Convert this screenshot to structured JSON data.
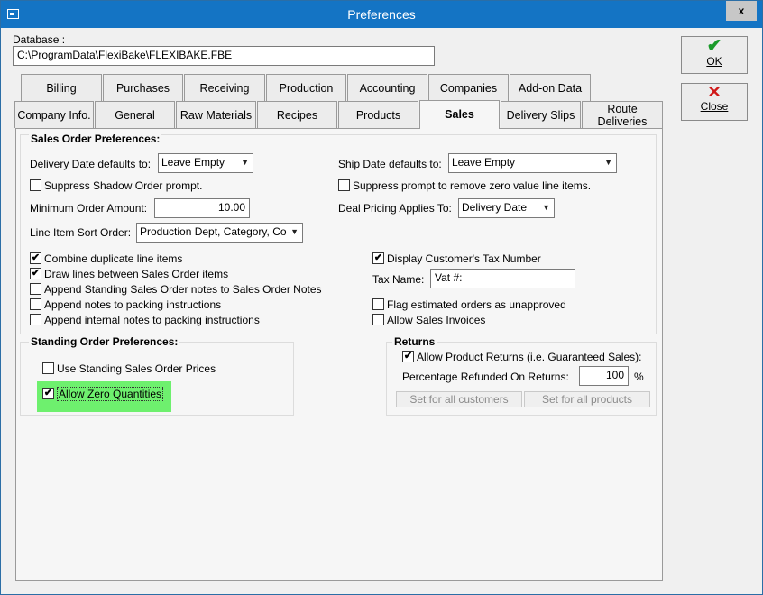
{
  "window": {
    "title": "Preferences",
    "close_glyph": "x"
  },
  "database": {
    "label": "Database :",
    "path": "C:\\ProgramData\\FlexiBake\\FLEXIBAKE.FBE"
  },
  "buttons": {
    "ok": "OK",
    "close": "Close"
  },
  "tabs_row1": [
    "Billing",
    "Purchases",
    "Receiving",
    "Production",
    "Accounting",
    "Companies",
    "Add-on Data"
  ],
  "tabs_row2": [
    "Company Info.",
    "General",
    "Raw Materials",
    "Recipes",
    "Products",
    "Sales",
    "Delivery Slips",
    "Route\nDeliveries"
  ],
  "active_tab": "Sales",
  "sales_order": {
    "title": "Sales Order Preferences:",
    "delivery_date_label": "Delivery Date defaults to:",
    "delivery_date_value": "Leave Empty",
    "ship_date_label": "Ship Date defaults to:",
    "ship_date_value": "Leave Empty",
    "suppress_shadow": {
      "label": "Suppress Shadow Order prompt.",
      "checked": false
    },
    "suppress_zero": {
      "label": "Suppress prompt to remove zero value line items.",
      "checked": false
    },
    "min_order_label": "Minimum Order Amount:",
    "min_order_value": "10.00",
    "deal_pricing_label": "Deal Pricing Applies To:",
    "deal_pricing_value": "Delivery Date",
    "sort_order_label": "Line Item Sort Order:",
    "sort_order_value": "Production Dept, Category, Co",
    "combine_dup": {
      "label": "Combine duplicate line items",
      "checked": true
    },
    "draw_lines": {
      "label": "Draw lines between Sales Order items",
      "checked": true
    },
    "append_standing": {
      "label": "Append Standing Sales Order notes to Sales Order Notes",
      "checked": false
    },
    "append_packing": {
      "label": "Append notes to packing instructions",
      "checked": false
    },
    "append_internal": {
      "label": "Append internal notes to packing instructions",
      "checked": false
    },
    "display_tax": {
      "label": "Display Customer's Tax Number",
      "checked": true
    },
    "tax_name_label": "Tax Name:",
    "tax_name_value": "Vat #:",
    "flag_estimated": {
      "label": "Flag estimated orders as unapproved",
      "checked": false
    },
    "allow_invoices": {
      "label": "Allow Sales Invoices",
      "checked": false
    }
  },
  "standing_order": {
    "title": "Standing Order Preferences:",
    "use_prices": {
      "label": "Use Standing Sales Order Prices",
      "checked": false
    },
    "allow_zero": {
      "label": "Allow Zero Quantities",
      "checked": true
    }
  },
  "returns": {
    "title": "Returns",
    "allow_returns": {
      "label": "Allow Product Returns (i.e. Guaranteed Sales):",
      "checked": true
    },
    "pct_label": "Percentage Refunded On Returns:",
    "pct_value": "100",
    "pct_unit": "%",
    "set_customers": "Set for all customers",
    "set_products": "Set for all products"
  },
  "colors": {
    "titlebar": "#1474c4",
    "highlight": "#6ef06e",
    "ok_green": "#1a9a2a",
    "close_red": "#d01818"
  },
  "icons": {
    "checkmark": "✔",
    "ok": "check-icon",
    "close": "x-icon"
  }
}
